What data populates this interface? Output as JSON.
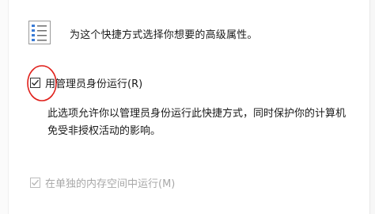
{
  "dialog": {
    "intro_text": "为这个快捷方式选择你想要的高级属性。",
    "icon": "properties-list-icon"
  },
  "run_as_admin": {
    "label": "用管理员身份运行(R)",
    "checked": true,
    "description_line1": "此选项允许你以管理员身份运行此快捷方式，同时保护你的计算机",
    "description_line2": "免受非授权活动的影响。"
  },
  "separate_memory": {
    "label": "在单独的内存空间中运行(M)",
    "checked": true,
    "disabled": true
  },
  "annotation": {
    "color": "#e0201b"
  }
}
